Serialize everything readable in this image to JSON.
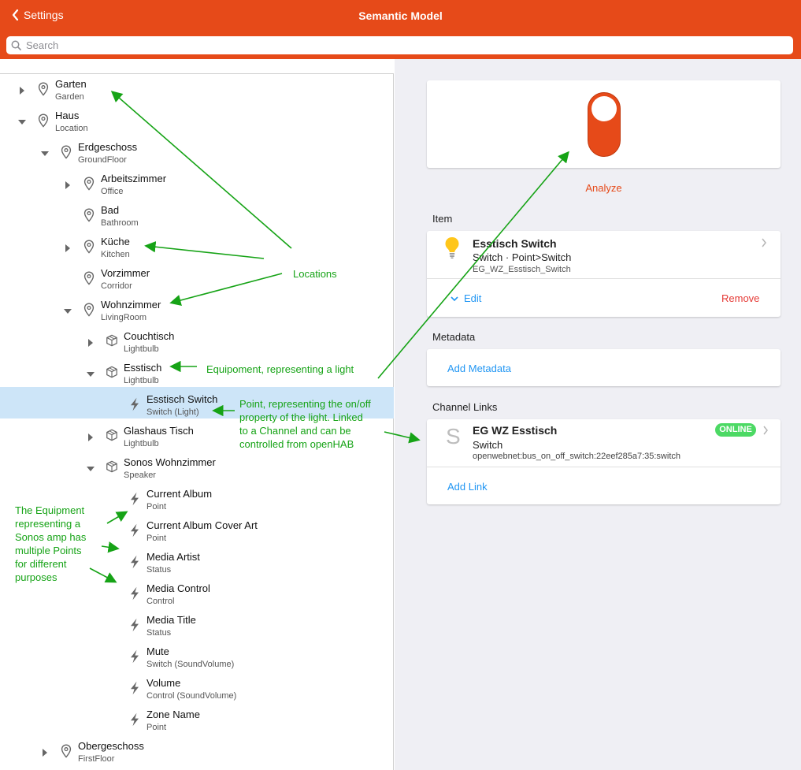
{
  "header": {
    "back_label": "Settings",
    "title": "Semantic Model"
  },
  "search": {
    "placeholder": "Search"
  },
  "tree": [
    {
      "name": "Garten",
      "sub": "Garden",
      "level": 0,
      "icon": "location-pin-icon",
      "toggle": "collapsed"
    },
    {
      "name": "Haus",
      "sub": "Location",
      "level": 0,
      "icon": "location-pin-icon",
      "toggle": "expanded"
    },
    {
      "name": "Erdgeschoss",
      "sub": "GroundFloor",
      "level": 1,
      "icon": "location-pin-icon",
      "toggle": "expanded"
    },
    {
      "name": "Arbeitszimmer",
      "sub": "Office",
      "level": 2,
      "icon": "location-pin-icon",
      "toggle": "collapsed"
    },
    {
      "name": "Bad",
      "sub": "Bathroom",
      "level": 2,
      "icon": "location-pin-icon",
      "toggle": "none"
    },
    {
      "name": "Küche",
      "sub": "Kitchen",
      "level": 2,
      "icon": "location-pin-icon",
      "toggle": "collapsed"
    },
    {
      "name": "Vorzimmer",
      "sub": "Corridor",
      "level": 2,
      "icon": "location-pin-icon",
      "toggle": "none"
    },
    {
      "name": "Wohnzimmer",
      "sub": "LivingRoom",
      "level": 2,
      "icon": "location-pin-icon",
      "toggle": "expanded"
    },
    {
      "name": "Couchtisch",
      "sub": "Lightbulb",
      "level": 3,
      "icon": "cube-icon",
      "toggle": "collapsed"
    },
    {
      "name": "Esstisch",
      "sub": "Lightbulb",
      "level": 3,
      "icon": "cube-icon",
      "toggle": "expanded"
    },
    {
      "name": "Esstisch Switch",
      "sub": "Switch (Light)",
      "level": 4,
      "icon": "bolt-icon",
      "toggle": "none",
      "selected": true
    },
    {
      "name": "Glashaus Tisch",
      "sub": "Lightbulb",
      "level": 3,
      "icon": "cube-icon",
      "toggle": "collapsed"
    },
    {
      "name": "Sonos Wohnzimmer",
      "sub": "Speaker",
      "level": 3,
      "icon": "cube-icon",
      "toggle": "expanded"
    },
    {
      "name": "Current Album",
      "sub": "Point",
      "level": 4,
      "icon": "bolt-icon",
      "toggle": "none"
    },
    {
      "name": "Current Album Cover Art",
      "sub": "Point",
      "level": 4,
      "icon": "bolt-icon",
      "toggle": "none"
    },
    {
      "name": "Media Artist",
      "sub": "Status",
      "level": 4,
      "icon": "bolt-icon",
      "toggle": "none"
    },
    {
      "name": "Media Control",
      "sub": "Control",
      "level": 4,
      "icon": "bolt-icon",
      "toggle": "none"
    },
    {
      "name": "Media Title",
      "sub": "Status",
      "level": 4,
      "icon": "bolt-icon",
      "toggle": "none"
    },
    {
      "name": "Mute",
      "sub": "Switch (SoundVolume)",
      "level": 4,
      "icon": "bolt-icon",
      "toggle": "none"
    },
    {
      "name": "Volume",
      "sub": "Control (SoundVolume)",
      "level": 4,
      "icon": "bolt-icon",
      "toggle": "none"
    },
    {
      "name": "Zone Name",
      "sub": "Point",
      "level": 4,
      "icon": "bolt-icon",
      "toggle": "none"
    },
    {
      "name": "Obergeschoss",
      "sub": "FirstFloor",
      "level": 1,
      "icon": "location-pin-icon",
      "toggle": "collapsed"
    }
  ],
  "detail": {
    "toggle_on": true,
    "analyze_label": "Analyze",
    "item_section": "Item",
    "item": {
      "name": "Esstisch Switch",
      "type": "Switch · Point>Switch",
      "id": "EG_WZ_Esstisch_Switch",
      "icon": "lightbulb-icon",
      "edit_label": "Edit",
      "remove_label": "Remove"
    },
    "metadata_section": "Metadata",
    "add_metadata_label": "Add Metadata",
    "channel_section": "Channel Links",
    "channel": {
      "initial": "S",
      "name": "EG WZ Esstisch",
      "type": "Switch",
      "uid": "openwebnet:bus_on_off_switch:22eef285a7:35:switch",
      "status": "ONLINE"
    },
    "add_link_label": "Add Link"
  },
  "annotations": {
    "locations": "Locations",
    "equipment": "Equipoment, representing a light",
    "point": [
      "Point, representing the on/off",
      "property of the light. Linked",
      "to a Channel and can be",
      "controlled from openHAB"
    ],
    "sonos": [
      "The Equipment",
      "representing a",
      "Sonos amp has",
      "multiple Points",
      "for different",
      "purposes"
    ]
  },
  "colors": {
    "brand": "#e64a19",
    "accent": "#2196f3",
    "danger": "#e53935",
    "online": "#4cd964",
    "annotation": "#16a316",
    "selected_row": "#cde5f8"
  }
}
